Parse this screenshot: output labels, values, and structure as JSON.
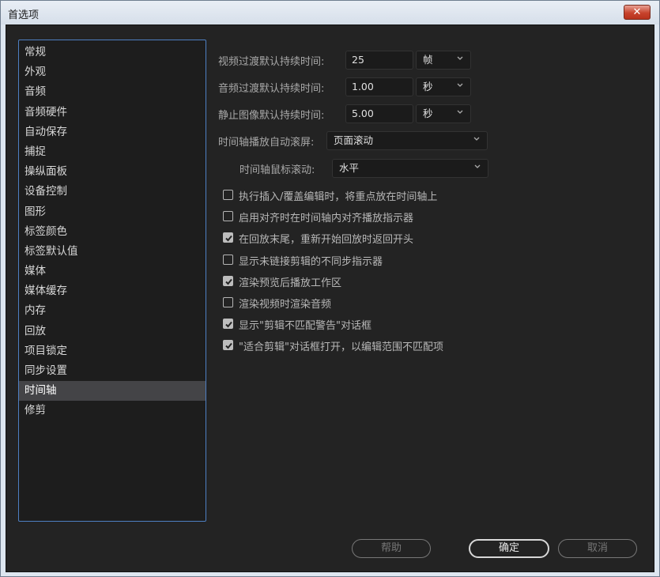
{
  "window": {
    "title": "首选项",
    "close_label": "✕"
  },
  "sidebar": {
    "items": [
      "常规",
      "外观",
      "音频",
      "音频硬件",
      "自动保存",
      "捕捉",
      "操纵面板",
      "设备控制",
      "图形",
      "标签颜色",
      "标签默认值",
      "媒体",
      "媒体缓存",
      "内存",
      "回放",
      "项目锁定",
      "同步设置",
      "时间轴",
      "修剪"
    ],
    "selected": "时间轴"
  },
  "settings": {
    "video_transition": {
      "label": "视频过渡默认持续时间:",
      "value": "25",
      "unit": "帧"
    },
    "audio_transition": {
      "label": "音频过渡默认持续时间:",
      "value": "1.00",
      "unit": "秒"
    },
    "still_image": {
      "label": "静止图像默认持续时间:",
      "value": "5.00",
      "unit": "秒"
    },
    "auto_scroll": {
      "label": "时间轴播放自动滚屏:",
      "value": "页面滚动"
    },
    "mouse_scroll": {
      "label": "时间轴鼠标滚动:",
      "value": "水平"
    }
  },
  "checkboxes": [
    {
      "label": "执行插入/覆盖编辑时，将重点放在时间轴上",
      "checked": false
    },
    {
      "label": "启用对齐时在时间轴内对齐播放指示器",
      "checked": false
    },
    {
      "label": "在回放末尾，重新开始回放时返回开头",
      "checked": true
    },
    {
      "label": "显示未链接剪辑的不同步指示器",
      "checked": false
    },
    {
      "label": "渲染预览后播放工作区",
      "checked": true
    },
    {
      "label": "渲染视频时渲染音频",
      "checked": false
    },
    {
      "label": "显示\"剪辑不匹配警告\"对话框",
      "checked": true
    },
    {
      "label": "\"适合剪辑\"对话框打开，以编辑范围不匹配项",
      "checked": true
    }
  ],
  "buttons": {
    "help": "帮助",
    "ok": "确定",
    "cancel": "取消"
  },
  "colors": {
    "accent_border": "#4e7fc2",
    "selected_bg": "#444447",
    "panel_bg": "#232323"
  }
}
